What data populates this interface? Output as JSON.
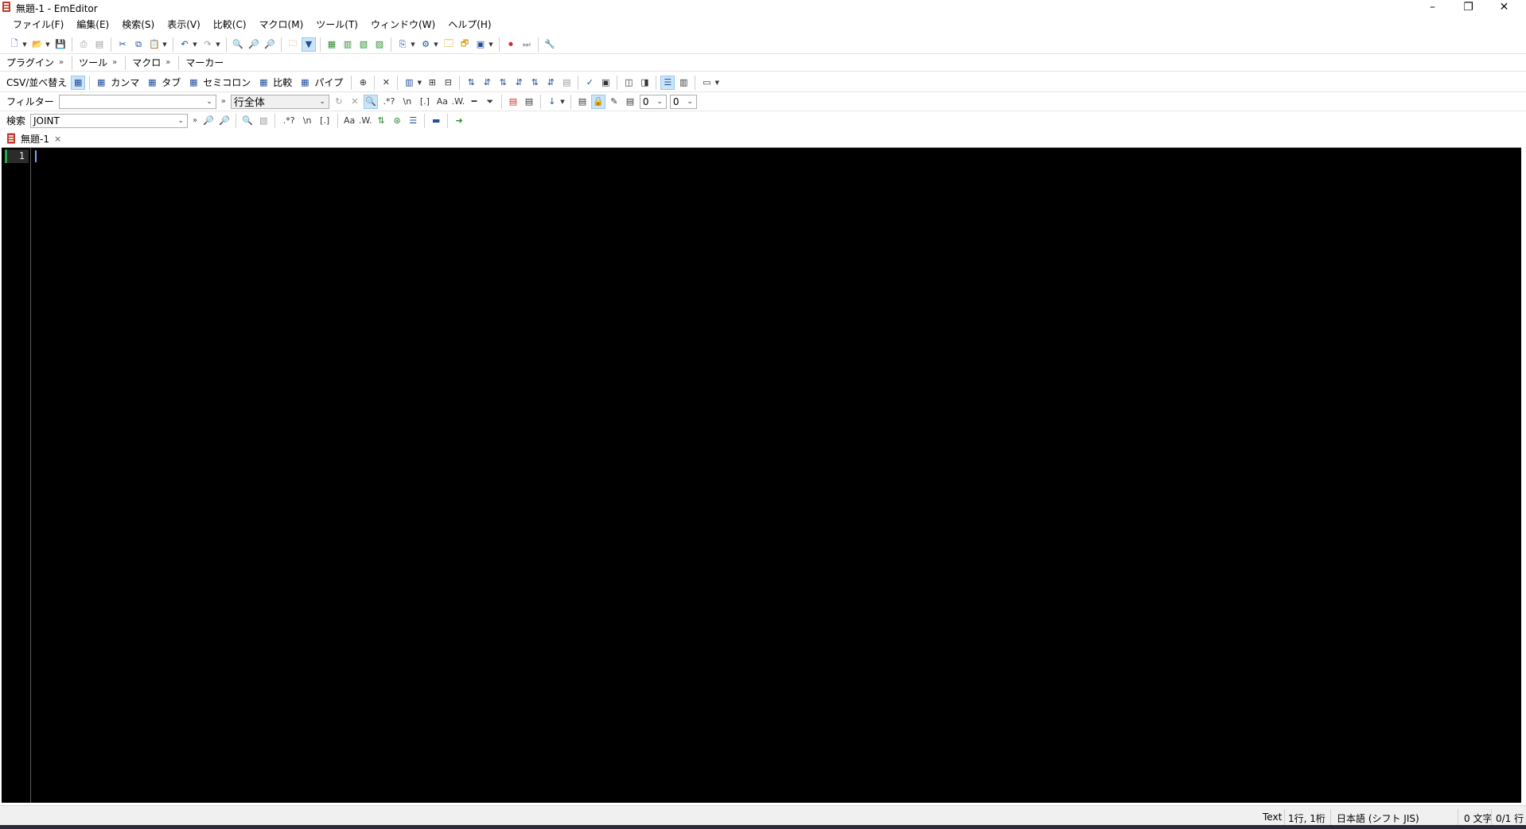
{
  "window": {
    "title": "無題-1 - EmEditor",
    "minimize_glyph": "–",
    "restore_glyph": "❐",
    "close_glyph": "✕"
  },
  "menu": [
    "ファイル(F)",
    "編集(E)",
    "検索(S)",
    "表示(V)",
    "比較(C)",
    "マクロ(M)",
    "ツール(T)",
    "ウィンドウ(W)",
    "ヘルプ(H)"
  ],
  "toolbar_groups": {
    "plugin": "プラグイン",
    "tools": "ツール",
    "macro": "マクロ",
    "marker": "マーカー",
    "chevron": "»"
  },
  "csv_bar": {
    "label": "CSV/並べ替え",
    "comma": "カンマ",
    "tab": "タブ",
    "semicolon": "セミコロン",
    "compare": "比較",
    "pipe": "パイプ"
  },
  "filter_bar": {
    "label": "フィルター",
    "value": "",
    "scope": "行全体",
    "chevron": "»",
    "regex": ".*?",
    "newline": "\\n",
    "bracket": "[.]",
    "num1": "0",
    "num2": "0"
  },
  "search_bar": {
    "label": "検索",
    "value": "JOINT",
    "chevron": "»",
    "regex": ".*?",
    "newline": "\\n",
    "bracket": "[.]"
  },
  "tab": {
    "label": "無題-1",
    "close": "×"
  },
  "editor": {
    "line_number": "1",
    "background": "#000000"
  },
  "status": {
    "mode": "Text",
    "position": "1行, 1桁",
    "encoding": "日本語 (シフト JIS)",
    "chars": "0 文字",
    "lines": "0/1 行"
  },
  "colors": {
    "accent_blue": "#1f4e9b",
    "stop_red": "#d12b2b",
    "gutter_green": "#28a745"
  }
}
